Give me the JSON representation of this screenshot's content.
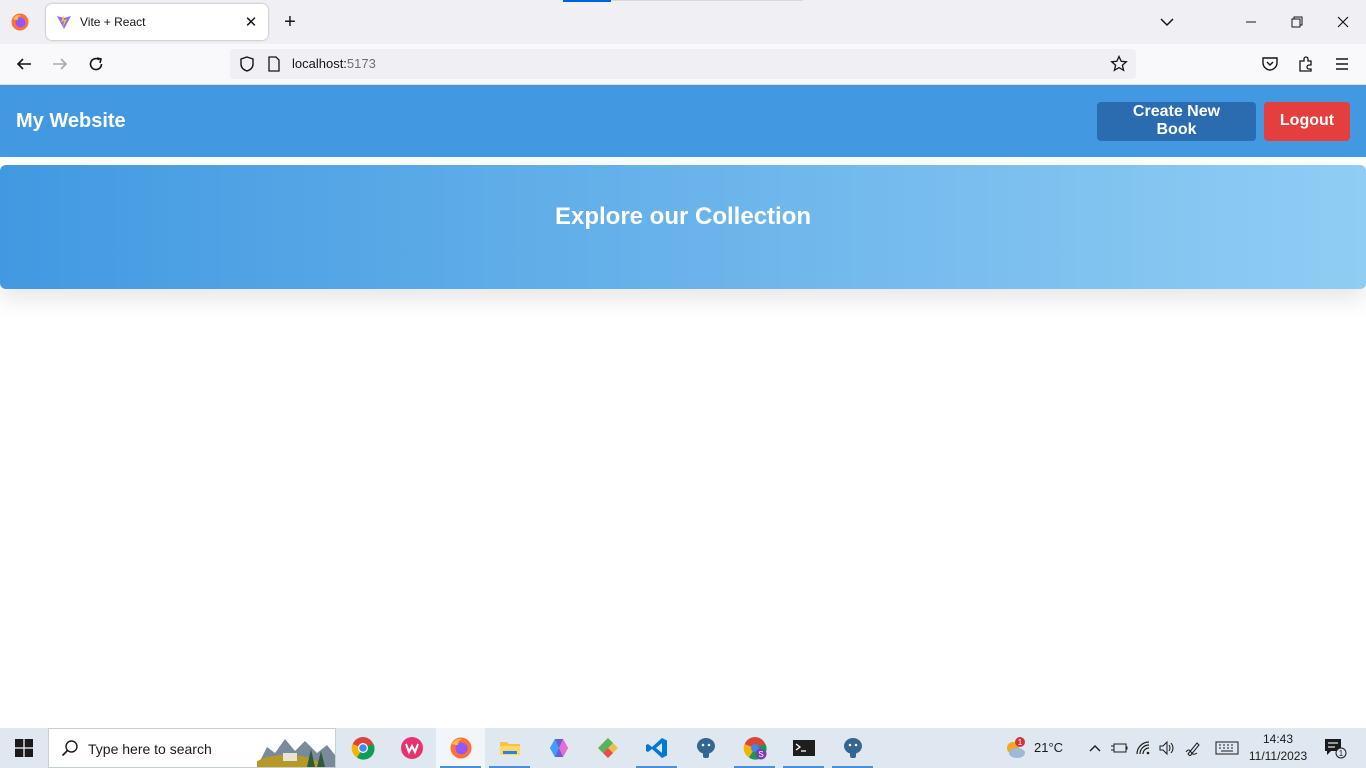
{
  "browser": {
    "tab_title": "Vite + React",
    "url_host": "localhost:",
    "url_port": "5173"
  },
  "site": {
    "title": "My Website",
    "create_button": "Create New Book",
    "logout_button": "Logout",
    "hero_title": "Explore our Collection"
  },
  "taskbar": {
    "search_placeholder": "Type here to search",
    "weather_badge": "1",
    "temperature": "21°C",
    "time": "14:43",
    "date": "11/11/2023",
    "notification_count": "1"
  },
  "colors": {
    "header": "#4299e1",
    "create_button": "#2b6cb0",
    "logout_button": "#e53e3e",
    "hero_gradient_start": "#4299e1",
    "hero_gradient_end": "#90cdf4"
  }
}
